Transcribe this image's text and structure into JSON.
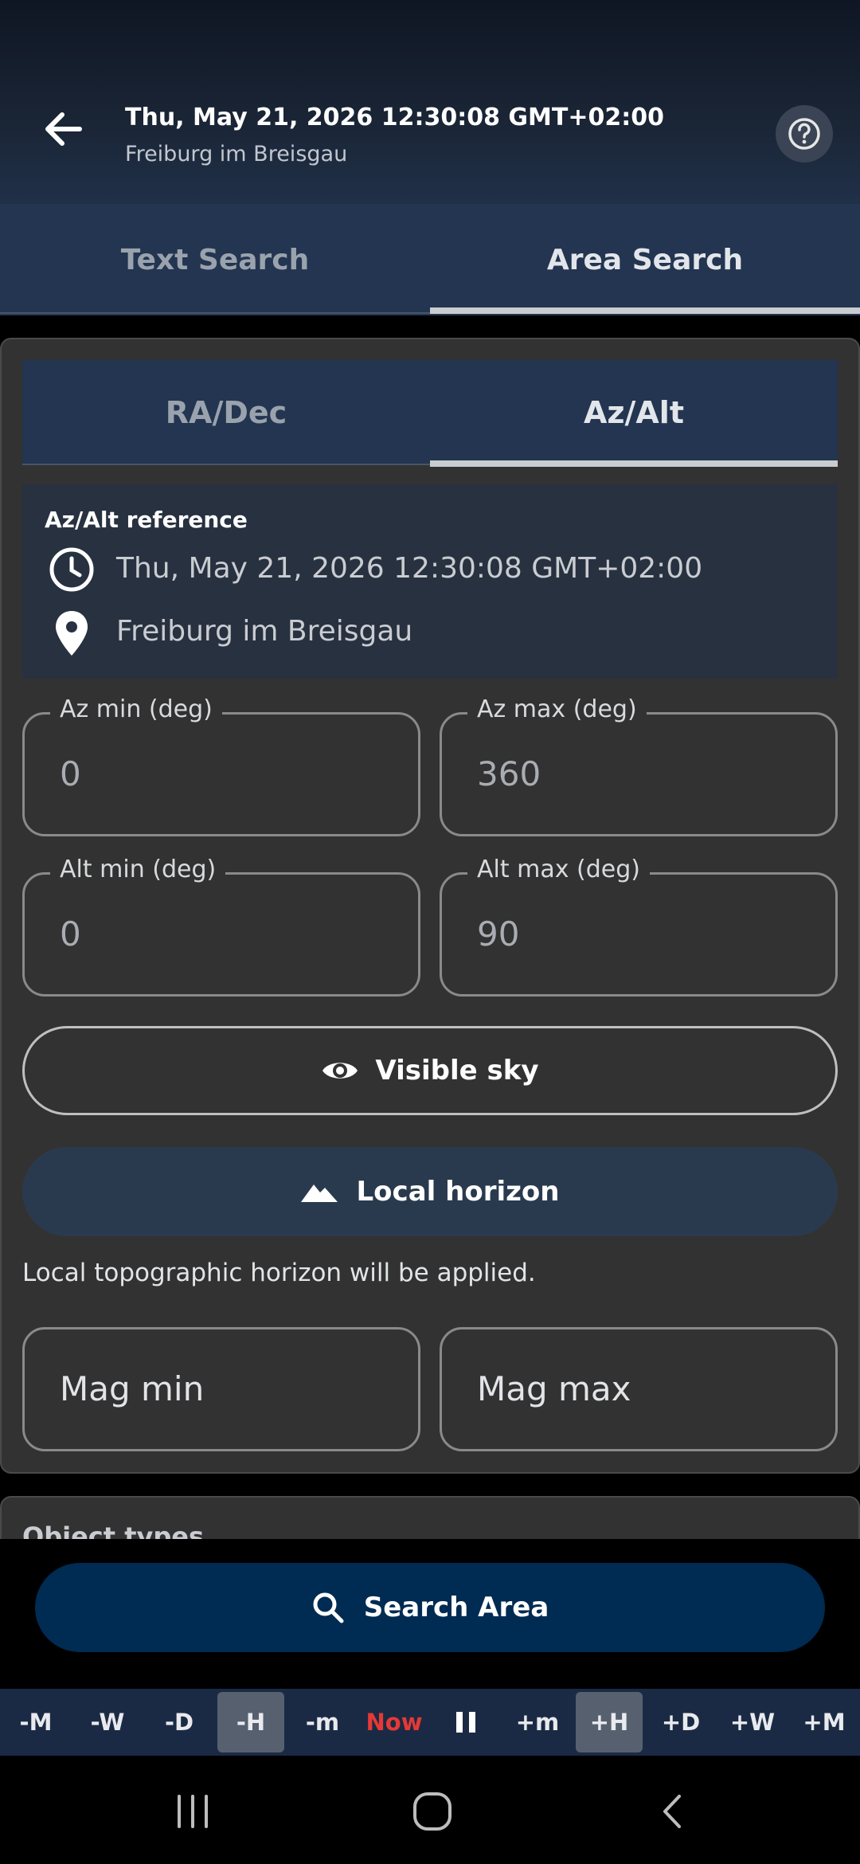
{
  "header": {
    "title": "Thu, May 21, 2026 12:30:08 GMT+02:00",
    "subtitle": "Freiburg im Breisgau",
    "back_icon": "arrow-left-icon",
    "help_icon": "help-circle-icon"
  },
  "tabs": [
    {
      "label": "Text Search",
      "selected": false
    },
    {
      "label": "Area Search",
      "selected": true
    }
  ],
  "subtabs": [
    {
      "label": "RA/Dec",
      "selected": false
    },
    {
      "label": "Az/Alt",
      "selected": true
    }
  ],
  "reference": {
    "title": "Az/Alt reference",
    "time": "Thu, May 21, 2026 12:30:08 GMT+02:00",
    "location": "Freiburg im Breisgau"
  },
  "fields": {
    "az_min": {
      "label": "Az min (deg)",
      "value": "0"
    },
    "az_max": {
      "label": "Az max (deg)",
      "value": "360"
    },
    "alt_min": {
      "label": "Alt min (deg)",
      "value": "0"
    },
    "alt_max": {
      "label": "Alt max (deg)",
      "value": "90"
    },
    "mag_min": {
      "value": "Mag min"
    },
    "mag_max": {
      "value": "Mag max"
    }
  },
  "buttons": {
    "visible_sky": "Visible sky",
    "local_horizon": "Local horizon",
    "search_area": "Search Area"
  },
  "note": "Local topographic horizon will be applied.",
  "object_types_title": "Object types",
  "timebar": [
    {
      "label": "-M",
      "active": false
    },
    {
      "label": "-W",
      "active": false
    },
    {
      "label": "-D",
      "active": false
    },
    {
      "label": "-H",
      "active": true
    },
    {
      "label": "-m",
      "active": false
    },
    {
      "label": "Now",
      "active": false
    },
    {
      "label": "pause",
      "active": false
    },
    {
      "label": "+m",
      "active": false
    },
    {
      "label": "+H",
      "active": true
    },
    {
      "label": "+D",
      "active": false
    },
    {
      "label": "+W",
      "active": false
    },
    {
      "label": "+M",
      "active": false
    }
  ],
  "colors": {
    "accent": "#233550",
    "search_button": "#002b52",
    "now": "#e53935"
  }
}
